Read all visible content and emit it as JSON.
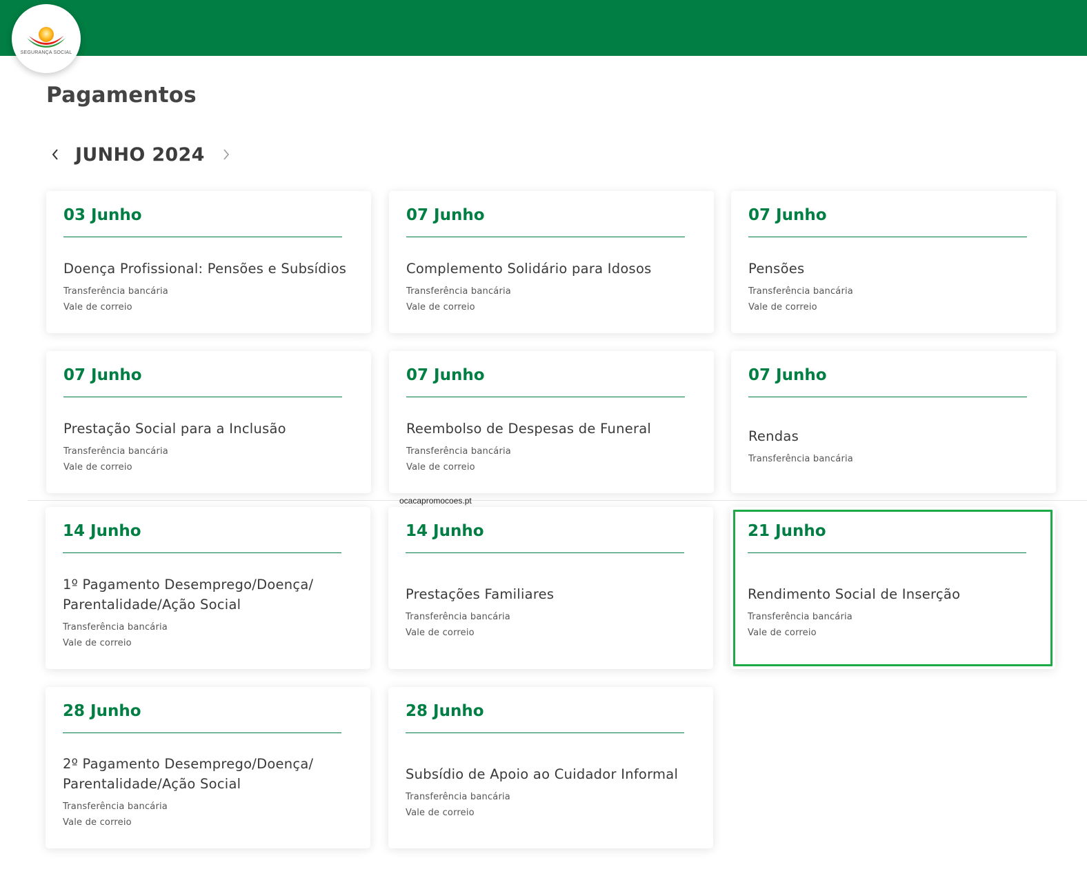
{
  "header": {
    "logo_text": "SEGURANÇA SOCIAL",
    "bar_color": "#007e43"
  },
  "page": {
    "title": "Pagamentos"
  },
  "month_nav": {
    "label": "JUNHO 2024",
    "prev_icon": "chevron-left-icon",
    "next_icon": "chevron-right-icon"
  },
  "watermark": "ocacapromocoes.pt",
  "accent_color": "#007e43",
  "highlight_color": "#1faa4a",
  "cards": [
    {
      "date": "03 Junho",
      "benefit": "Doença Profissional: Pensões e Subsídios",
      "methods": [
        "Transferência bancária",
        "Vale de correio"
      ]
    },
    {
      "date": "07 Junho",
      "benefit": "Complemento Solidário para Idosos",
      "methods": [
        "Transferência bancária",
        "Vale de correio"
      ]
    },
    {
      "date": "07 Junho",
      "benefit": "Pensões",
      "methods": [
        "Transferência bancária",
        "Vale de correio"
      ]
    },
    {
      "date": "07 Junho",
      "benefit": "Prestação Social para a Inclusão",
      "methods": [
        "Transferência bancária",
        "Vale de correio"
      ]
    },
    {
      "date": "07 Junho",
      "benefit": "Reembolso de Despesas de Funeral",
      "methods": [
        "Transferência bancária",
        "Vale de correio"
      ]
    },
    {
      "date": "07 Junho",
      "benefit": "Rendas",
      "methods": [
        "Transferência bancária"
      ]
    },
    {
      "date": "14 Junho",
      "benefit": "1º Pagamento Desemprego/Doença/ Parentalidade/Ação Social",
      "methods": [
        "Transferência bancária",
        "Vale de correio"
      ]
    },
    {
      "date": "14 Junho",
      "benefit": "Prestações Familiares",
      "methods": [
        "Transferência bancária",
        "Vale de correio"
      ]
    },
    {
      "date": "21 Junho",
      "benefit": "Rendimento Social de Inserção",
      "methods": [
        "Transferência bancária",
        "Vale de correio"
      ],
      "highlighted": true
    },
    {
      "date": "28 Junho",
      "benefit": "2º Pagamento Desemprego/Doença/ Parentalidade/Ação Social",
      "methods": [
        "Transferência bancária",
        "Vale de correio"
      ]
    },
    {
      "date": "28 Junho",
      "benefit": "Subsídio de Apoio ao Cuidador Informal",
      "methods": [
        "Transferência bancária",
        "Vale de correio"
      ]
    }
  ]
}
